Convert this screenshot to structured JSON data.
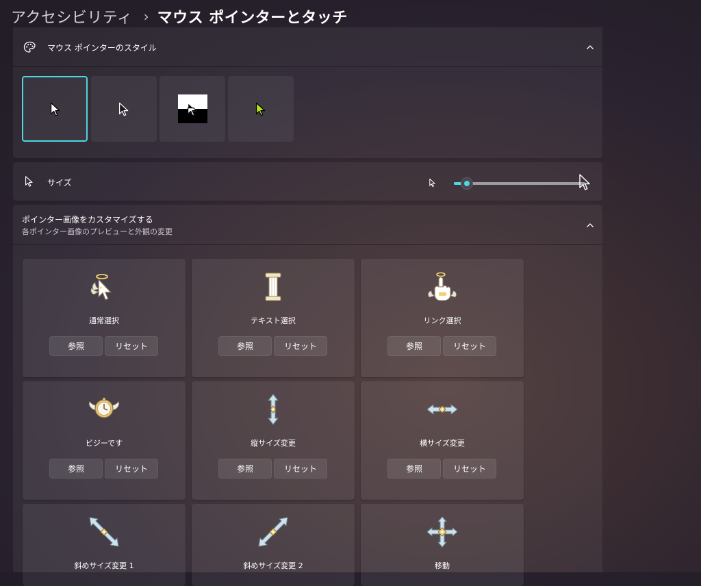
{
  "breadcrumb": {
    "parent": "アクセシビリティ",
    "separator": "›",
    "current": "マウス ポインターとタッチ"
  },
  "pointer_style": {
    "label": "マウス ポインターのスタイル",
    "icon": "palette-icon",
    "expanded": true,
    "options": [
      {
        "name": "white",
        "selected": true
      },
      {
        "name": "black",
        "selected": false
      },
      {
        "name": "inverted",
        "selected": false
      },
      {
        "name": "custom",
        "selected": false,
        "color": "#b7e51c"
      }
    ]
  },
  "size": {
    "label": "サイズ",
    "icon": "pointer-icon",
    "value_fraction": 0.1,
    "accent": "#4fd6e0"
  },
  "customize": {
    "title": "ポインター画像をカスタマイズする",
    "subtitle": "各ポインター画像のプレビューと外観の変更",
    "expanded": true,
    "browse_label": "参照",
    "reset_label": "リセット",
    "pointers": [
      {
        "name": "通常選択",
        "icon": "angel-arrow-icon"
      },
      {
        "name": "テキスト選択",
        "icon": "pillar-text-icon"
      },
      {
        "name": "リンク選択",
        "icon": "angel-hand-icon"
      },
      {
        "name": "ビジーです",
        "icon": "winged-clock-icon"
      },
      {
        "name": "縦サイズ変更",
        "icon": "vertical-resize-icon"
      },
      {
        "name": "横サイズ変更",
        "icon": "horizontal-resize-icon"
      },
      {
        "name": "斜めサイズ変更 1",
        "icon": "diagonal-resize-1-icon"
      },
      {
        "name": "斜めサイズ変更 2",
        "icon": "diagonal-resize-2-icon"
      },
      {
        "name": "移動",
        "icon": "move-icon"
      }
    ]
  }
}
